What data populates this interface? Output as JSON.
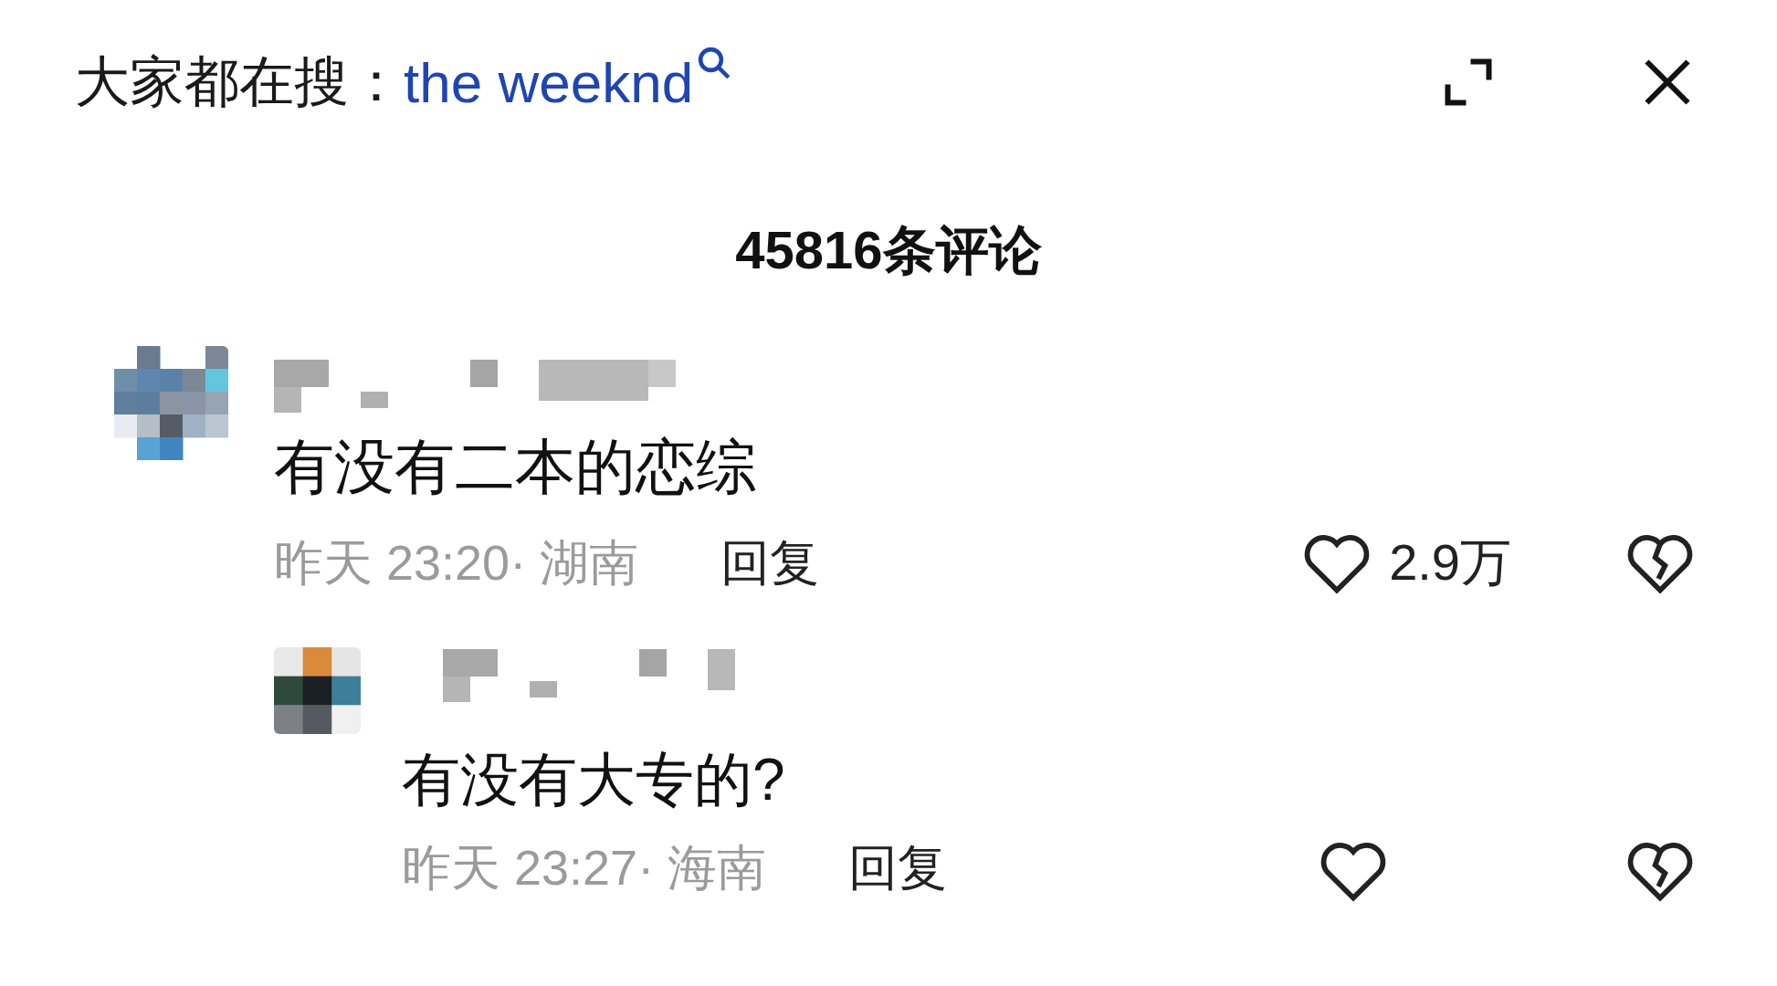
{
  "header": {
    "label": "大家都在搜：",
    "query": "the weeknd"
  },
  "comment_count": "45816条评论",
  "comments": [
    {
      "text": "有没有二本的恋综",
      "meta": "昨天 23:20· 湖南",
      "reply_label": "回复",
      "likes": "2.9万",
      "replies": [
        {
          "text": "有没有大专的?",
          "meta": "昨天 23:27· 海南",
          "reply_label": "回复"
        }
      ]
    }
  ]
}
